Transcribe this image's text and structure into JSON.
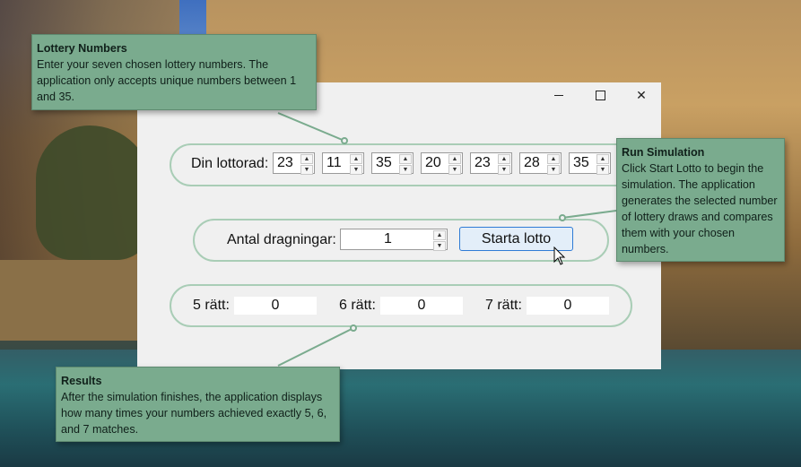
{
  "window": {
    "buttons": {
      "minimize": "minimize-icon",
      "maximize": "maximize-icon",
      "close": "close-icon"
    }
  },
  "row": {
    "label": "Din lottorad:",
    "numbers": [
      "23",
      "11",
      "35",
      "20",
      "23",
      "28",
      "35"
    ]
  },
  "draws": {
    "label": "Antal dragningar:",
    "value": "1",
    "start_label": "Starta lotto"
  },
  "results": {
    "five_label": "5 rätt:",
    "five_value": "0",
    "six_label": "6 rätt:",
    "six_value": "0",
    "seven_label": "7 rätt:",
    "seven_value": "0"
  },
  "callouts": {
    "lottery": {
      "title": "Lottery Numbers",
      "text": "Enter your seven chosen lottery numbers. The application only accepts unique numbers between 1 and 35."
    },
    "simulation": {
      "title": "Run Simulation",
      "text": "Click Start Lotto to begin the simulation. The application generates the selected number of lottery draws and compares them with your chosen numbers."
    },
    "results": {
      "title": "Results",
      "text": "After the simulation finishes, the application displays how many times your numbers achieved exactly 5, 6, and 7 matches."
    }
  },
  "colors": {
    "accent": "#2f7bd6",
    "group_border": "#a9cdb6",
    "callout_bg": "#7aab8e"
  }
}
